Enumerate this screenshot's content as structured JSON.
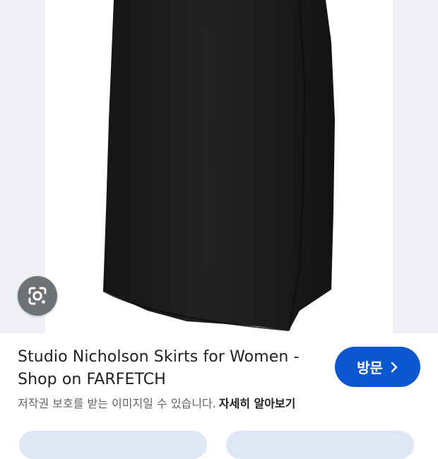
{
  "result": {
    "title_line1": "Studio Nicholson Skirts for Women -",
    "title_line2": "Shop on FARFETCH",
    "visit_label": "방문",
    "copyright_notice": "저작권 보호를 받는 이미지일 수 있습니다.",
    "learn_more_label": "자세히 알아보기"
  },
  "icons": {
    "lens": "google-lens-icon",
    "visit_chevron": "chevron-right-icon"
  },
  "colors": {
    "accent": "#0b57d0",
    "lens_button": "#6f7274",
    "image_backdrop": "#eef0f3",
    "skirt": "#1d1d1d",
    "chip": "#dfe7f6"
  }
}
